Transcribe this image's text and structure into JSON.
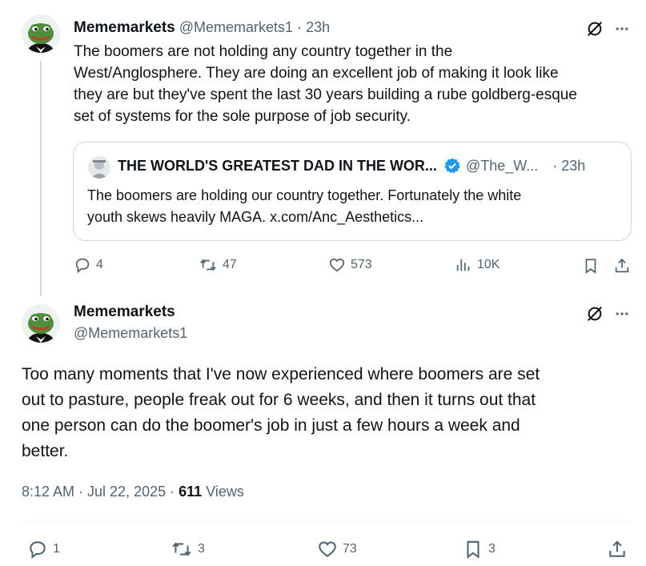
{
  "post1": {
    "display_name": "Mememarkets",
    "handle": "@Mememarkets1",
    "separator": "·",
    "time": "23h",
    "text_lines": [
      "The boomers are not holding any country together in the",
      "West/Anglosphere. They are doing an excellent job of making it look like",
      "they are but they've spent the last 30 years building a rube goldberg-esque",
      "set of systems for the sole purpose of job security."
    ],
    "quote": {
      "display_name": "THE WORLD'S GREATEST DAD IN THE WOR...",
      "handle": "@The_W...",
      "time": "· 23h",
      "text_lines": [
        "The boomers are holding our country together. Fortunately the white",
        "youth skews heavily MAGA. x.com/Anc_Aesthetics..."
      ]
    },
    "actions": {
      "replies": "4",
      "reposts": "47",
      "likes": "573",
      "views": "10K"
    }
  },
  "post2": {
    "display_name": "Mememarkets",
    "handle": "@Mememarkets1",
    "text_lines": [
      "Too many moments that I've now experienced where boomers are set",
      "out to pasture, people freak out for 6 weeks, and then it turns out that",
      "one person can do the boomer's job in just a few hours a week and",
      "better."
    ],
    "timestamp": "8:12 AM · Jul 22, 2025",
    "dot": "·",
    "views_count": "611",
    "views_label": "Views",
    "actions": {
      "replies": "1",
      "reposts": "3",
      "likes": "73",
      "bookmarks": "3"
    }
  },
  "icons": {
    "more": "more-dots-icon",
    "grok": "grok-icon",
    "verified_color": "#1d9bf0"
  }
}
